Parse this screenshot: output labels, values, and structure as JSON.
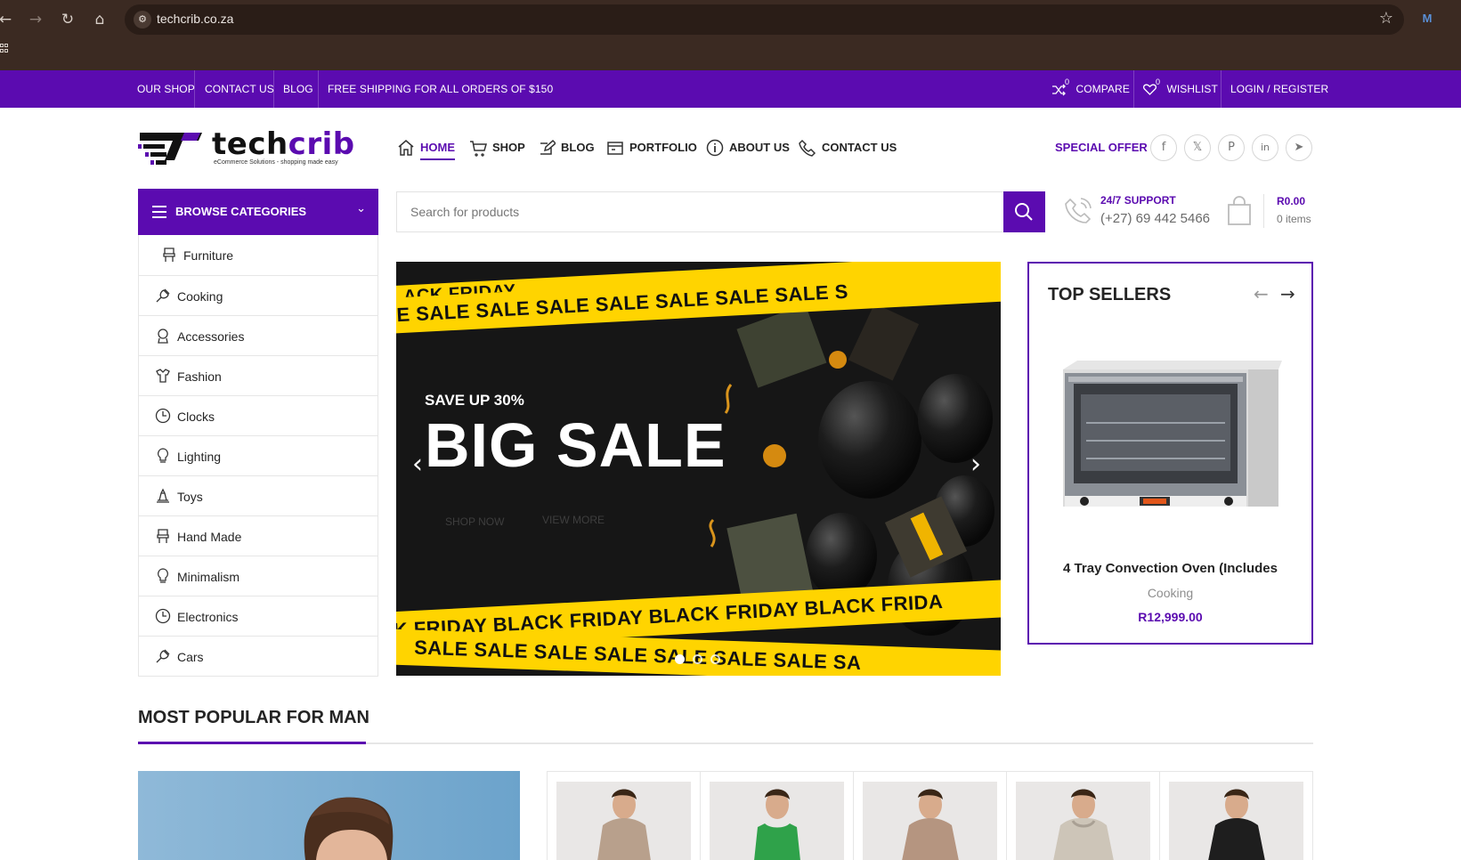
{
  "browser": {
    "url": "techcrib.co.za",
    "nav": {
      "back": "←",
      "forward": "→",
      "reload": "↻",
      "home": "⌂"
    },
    "star": "☆",
    "extension": "M"
  },
  "topbar": {
    "links": [
      "OUR SHOP",
      "CONTACT US",
      "BLOG"
    ],
    "promo": "FREE SHIPPING FOR ALL ORDERS OF $150",
    "compare": {
      "label": "COMPARE",
      "count": "0"
    },
    "wishlist": {
      "label": "WISHLIST",
      "count": "0"
    },
    "login": "LOGIN / REGISTER"
  },
  "logo": {
    "part1": "tech",
    "part2": "crib",
    "tagline": "eCommerce Solutions - shopping made easy"
  },
  "mainnav": [
    {
      "label": "HOME",
      "icon": "home-icon",
      "active": true
    },
    {
      "label": "SHOP",
      "icon": "cart-icon"
    },
    {
      "label": "BLOG",
      "icon": "edit-icon"
    },
    {
      "label": "PORTFOLIO",
      "icon": "portfolio-icon"
    },
    {
      "label": "ABOUT US",
      "icon": "info-icon"
    },
    {
      "label": "CONTACT US",
      "icon": "phone-icon"
    }
  ],
  "special_offer": "SPECIAL OFFER",
  "social": [
    {
      "name": "facebook-icon",
      "glyph": "f"
    },
    {
      "name": "x-icon",
      "glyph": "𝕏"
    },
    {
      "name": "pinterest-icon",
      "glyph": "P"
    },
    {
      "name": "linkedin-icon",
      "glyph": "in"
    },
    {
      "name": "telegram-icon",
      "glyph": "➤"
    }
  ],
  "browse": {
    "title": "BROWSE CATEGORIES",
    "chevron": "⌄"
  },
  "categories": [
    {
      "label": "Furniture",
      "icon": "chair-icon"
    },
    {
      "label": "Cooking",
      "icon": "cooking-icon"
    },
    {
      "label": "Accessories",
      "icon": "accessories-icon"
    },
    {
      "label": "Fashion",
      "icon": "fashion-icon"
    },
    {
      "label": "Clocks",
      "icon": "clock-icon"
    },
    {
      "label": "Lighting",
      "icon": "bulb-icon"
    },
    {
      "label": "Toys",
      "icon": "toy-icon"
    },
    {
      "label": "Hand Made",
      "icon": "chair-icon"
    },
    {
      "label": "Minimalism",
      "icon": "bulb-icon"
    },
    {
      "label": "Electronics",
      "icon": "clock-icon"
    },
    {
      "label": "Cars",
      "icon": "cooking-icon"
    }
  ],
  "search": {
    "placeholder": "Search for products"
  },
  "support": {
    "title": "24/7 SUPPORT",
    "phone": "(+27) 69 442 5466"
  },
  "cart": {
    "amount": "R0.00",
    "items": "0 items"
  },
  "hero": {
    "eyebrow": "SAVE UP 30%",
    "headline": "BIG SALE",
    "btn1": "SHOP NOW",
    "btn2": "VIEW MORE",
    "tape_top_1": "BLACK FRIDAY",
    "tape_top_2": "E  SALE   SALE   SALE   SALE   SALE   SALE   SALE   S",
    "tape_bottom_1": "CK FRIDAY   BLACK FRIDAY   BLACK FRIDAY   BLACK FRIDA",
    "tape_bottom_2": "SALE   SALE   SALE   SALE   SALE   SALE   SALE   SA",
    "prev": "‹",
    "next": "›",
    "slides": 3,
    "active_slide": 1
  },
  "top_sellers": {
    "title": "TOP SELLERS",
    "prev": "←",
    "next": "→",
    "product": {
      "name": "4 Tray Convection Oven (Includes",
      "category": "Cooking",
      "price": "R12,999.00"
    }
  },
  "most_popular": {
    "title": "MOST POPULAR FOR MAN"
  },
  "colors": {
    "brand": "#5b0bb0",
    "tape": "#ffd400",
    "chrome": "#3b2a22"
  }
}
